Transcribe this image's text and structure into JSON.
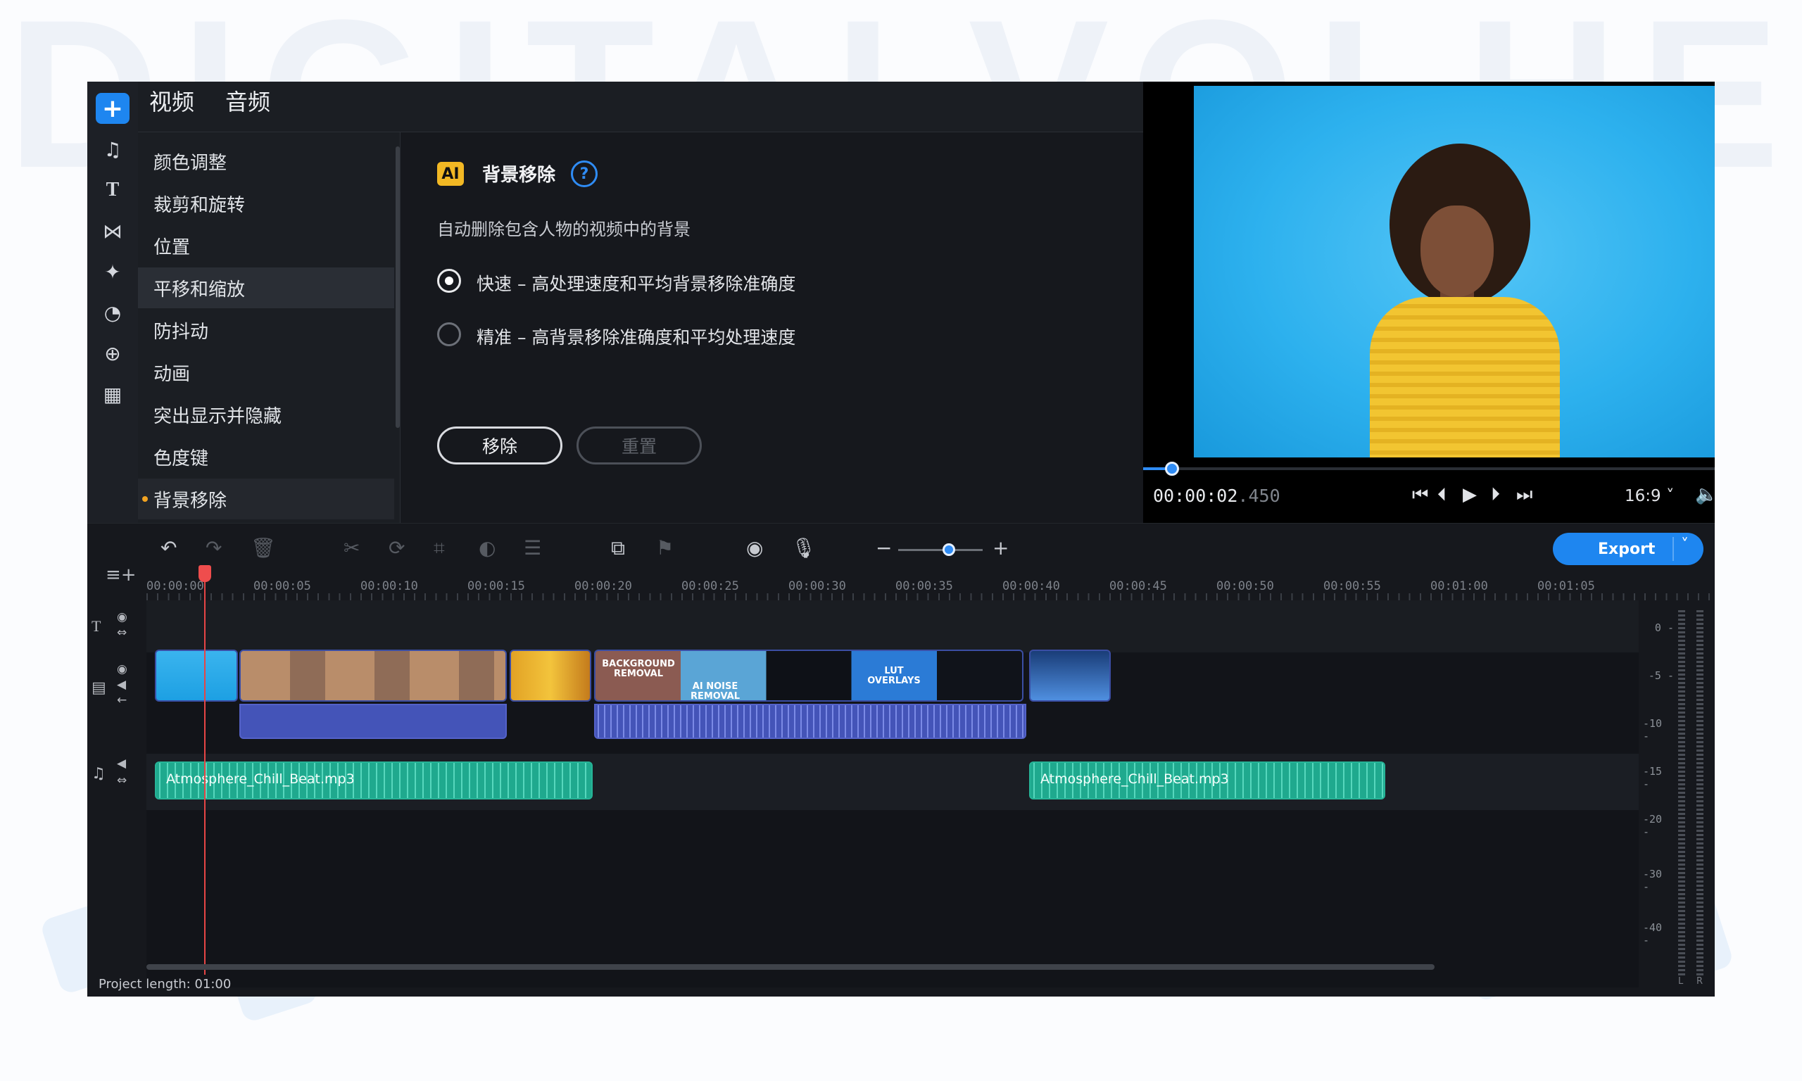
{
  "left_tabs": [
    "视频",
    "音频"
  ],
  "menu": {
    "items": [
      "颜色调整",
      "裁剪和旋转",
      "位置",
      "平移和缩放",
      "防抖动",
      "动画",
      "突出显示并隐藏",
      "色度键",
      "背景移除"
    ],
    "highlighted": "平移和缩放",
    "active": "背景移除"
  },
  "options": {
    "badge": "AI",
    "title": "背景移除",
    "help_glyph": "?",
    "description": "自动删除包含人物的视频中的背景",
    "modes": [
      {
        "label": "快速 – 高处理速度和平均背景移除准确度",
        "checked": true
      },
      {
        "label": "精准 – 高背景移除准确度和平均处理速度",
        "checked": false
      }
    ],
    "remove_label": "移除",
    "reset_label": "重置"
  },
  "preview": {
    "timecode_main": "00:00:02",
    "timecode_ms": ".450",
    "aspect": "16:9 ˅",
    "progress_fraction": 0.05
  },
  "toolbar": {
    "export_label": "Export",
    "zoom_fraction": 0.6
  },
  "ruler": [
    "00:00:00",
    "00:00:05",
    "00:00:10",
    "00:00:15",
    "00:00:20",
    "00:00:25",
    "00:00:30",
    "00:00:35",
    "00:00:40",
    "00:00:45",
    "00:00:50",
    "00:00:55",
    "00:01:00",
    "00:01:05"
  ],
  "tracks": {
    "music_clip_1": "Atmosphere_Chill_Beat.mp3",
    "music_clip_2": "Atmosphere_Chill_Beat.mp3",
    "clip4_texts": [
      "BACKGROUND REMOVAL",
      "AI NOISE REMOVAL",
      "LUT OVERLAYS"
    ]
  },
  "meter": {
    "db_labels": [
      "0",
      "-5",
      "-10",
      "-15",
      "-20",
      "-30",
      "-40"
    ],
    "l": "L",
    "r": "R"
  },
  "status": "Project length: 01:00",
  "colors": {
    "accent": "#1e86f0",
    "playhead": "#e64545",
    "music_clip": "#1fa98e",
    "video_audio": "#4454b8",
    "ai_badge": "#f2b824"
  }
}
